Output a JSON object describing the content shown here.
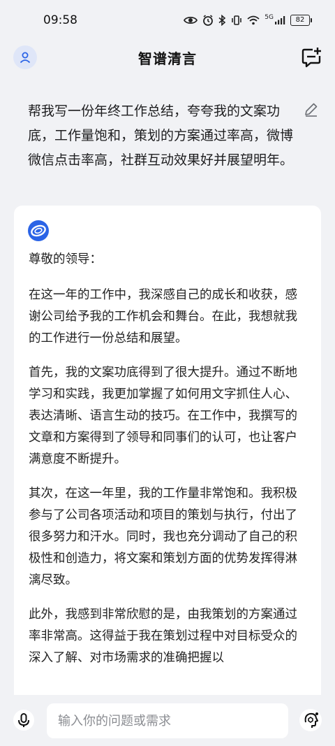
{
  "status_bar": {
    "time": "09:58",
    "network": "5G",
    "battery": "82"
  },
  "header": {
    "title": "智谱清言"
  },
  "query": {
    "text": "帮我写一份年终工作总结，夸夸我的文案功底，工作量饱和，策划的方案通过率高，微博微信点击率高，社群互动效果好并展望明年。"
  },
  "answer": {
    "greeting": "尊敬的领导：",
    "paragraphs": [
      "在这一年的工作中，我深感自己的成长和收获，感谢公司给予我的工作机会和舞台。在此，我想就我的工作进行一份总结和展望。",
      "首先，我的文案功底得到了很大提升。通过不断地学习和实践，我更加掌握了如何用文字抓住人心、表达清晰、语言生动的技巧。在工作中，我撰写的文章和方案得到了领导和同事们的认可，也让客户满意度不断提升。",
      "其次，在这一年里，我的工作量非常饱和。我积极参与了公司各项活动和项目的策划与执行，付出了很多努力和汗水。同时，我也充分调动了自己的积极性和创造力，将文案和策划方面的优势发挥得淋漓尽致。",
      "此外，我感到非常欣慰的是，由我策划的方案通过率非常高。这得益于我在策划过程中对目标受众的深入了解、对市场需求的准确把握以"
    ]
  },
  "input": {
    "placeholder": "输入你的问题或需求"
  },
  "colors": {
    "background": "#f1f2f5",
    "card": "#ffffff",
    "accent": "#2b64e6"
  }
}
